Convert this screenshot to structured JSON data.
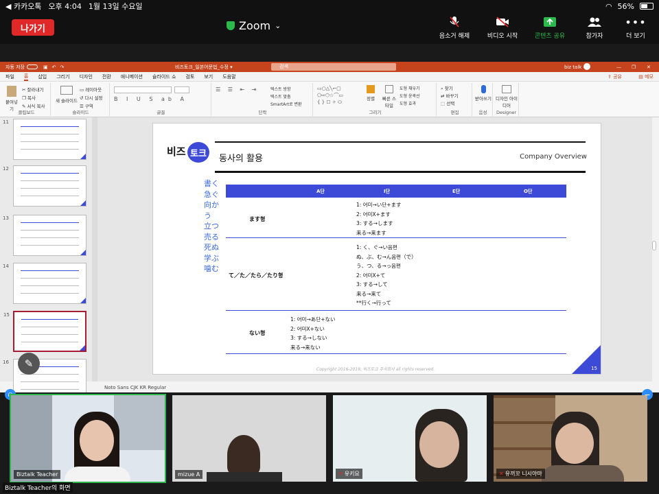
{
  "status_bar": {
    "carrier": "◀ 카카오톡",
    "time": "오후 4:04",
    "date": "1월 13일 수요일",
    "battery": "56%",
    "battery_fraction": 0.56
  },
  "zoom": {
    "leave_label": "나가기",
    "title": "Zoom",
    "controls": [
      {
        "label": "음소거 해제",
        "icon": "mic-muted-icon"
      },
      {
        "label": "비디오 시작",
        "icon": "video-off-icon"
      },
      {
        "label": "콘텐츠 공유",
        "icon": "share-content-icon"
      },
      {
        "label": "참가자",
        "icon": "participants-icon"
      },
      {
        "label": "더 보기",
        "icon": "more-icon"
      }
    ],
    "colors": {
      "leave": "#e02828",
      "share": "#2db84d",
      "accent": "#2d8cff"
    }
  },
  "ppt": {
    "autosave": "자동 저장",
    "filename": "비즈토크_일본어문법_수정 ▾",
    "search_placeholder": "검색",
    "user": "biz talk",
    "menu": [
      "파일",
      "홈",
      "삽입",
      "그리기",
      "디자인",
      "전환",
      "애니메이션",
      "슬라이드 쇼",
      "검토",
      "보기",
      "도움말"
    ],
    "active_menu": 1,
    "share_label": "공유",
    "memo_label": "메모",
    "ribbon": {
      "paste": "붙여넣기",
      "cut": "잘라내기",
      "copy": "복사",
      "format": "서식 복사",
      "clipboard": "클립보드",
      "new_slide": "새 슬라이드",
      "layout": "레이아웃",
      "reset": "다시 설정",
      "section": "구역",
      "slides": "슬라이드",
      "font": "글꼴",
      "text_dir": "텍스트 방향",
      "text_align": "텍스트 맞춤",
      "smartart": "SmartArt로 변환",
      "paragraph": "단락",
      "arrange": "정렬",
      "quick_styles": "빠른 스타일",
      "shape_fill": "도형 채우기",
      "shape_outline": "도형 윤곽선",
      "shape_effects": "도형 효과",
      "drawing": "그리기",
      "find": "찾기",
      "replace": "바꾸기",
      "select": "선택",
      "editing": "편집",
      "dictate": "받아쓰기",
      "voice": "음성",
      "designer_ideas": "디자인 아이디어",
      "designer": "Designer"
    },
    "thumb_numbers": [
      "11",
      "12",
      "13",
      "14",
      "15",
      "16"
    ],
    "selected_thumb": "15",
    "font_status": "Noto Sans CJK KR Regular"
  },
  "slide": {
    "logo_text": "비즈",
    "logo_bubble": "토크",
    "title": "동사의 활용",
    "subtitle": "Company Overview",
    "verbs": [
      "書く",
      "急ぐ",
      "向かう",
      "立つ",
      "売る",
      "死ぬ",
      "学ぶ",
      "噛む"
    ],
    "headers": [
      "A단",
      "I단",
      "E단",
      "O단"
    ],
    "rows": [
      {
        "label": "ます형",
        "text": "1: 어미→い단+ます\n2: 어미X+ます\n3: する→します\n来る→来ます"
      },
      {
        "label": "て／た／たら／たり형",
        "text": "1: く、ぐ→い음편\nぬ、ぶ、む→ん음편（で）\nう、つ、る→っ음편\n2: 어미X+て\n3: する→して\n来る→来て\n**行く→行って"
      },
      {
        "label": "ない형",
        "text": "1: 어미→あ단+ない\n2: 어미X+ない\n3: する→しない\n来る→来ない"
      }
    ],
    "copyright": "Copyright 2016-2019, 비즈토크 주식회사 all rights reserved.",
    "page": "15",
    "accent": "#3d4ad8"
  },
  "participants": [
    {
      "name": "Biztalk Teacher",
      "muted": false,
      "active": true
    },
    {
      "name": "mizue A",
      "muted": false,
      "active": false
    },
    {
      "name": "유키요",
      "muted": true,
      "active": false
    },
    {
      "name": "유끼꼬 니시야마",
      "muted": true,
      "active": false
    }
  ],
  "screen_label": "Biztalk Teacher의 화면"
}
